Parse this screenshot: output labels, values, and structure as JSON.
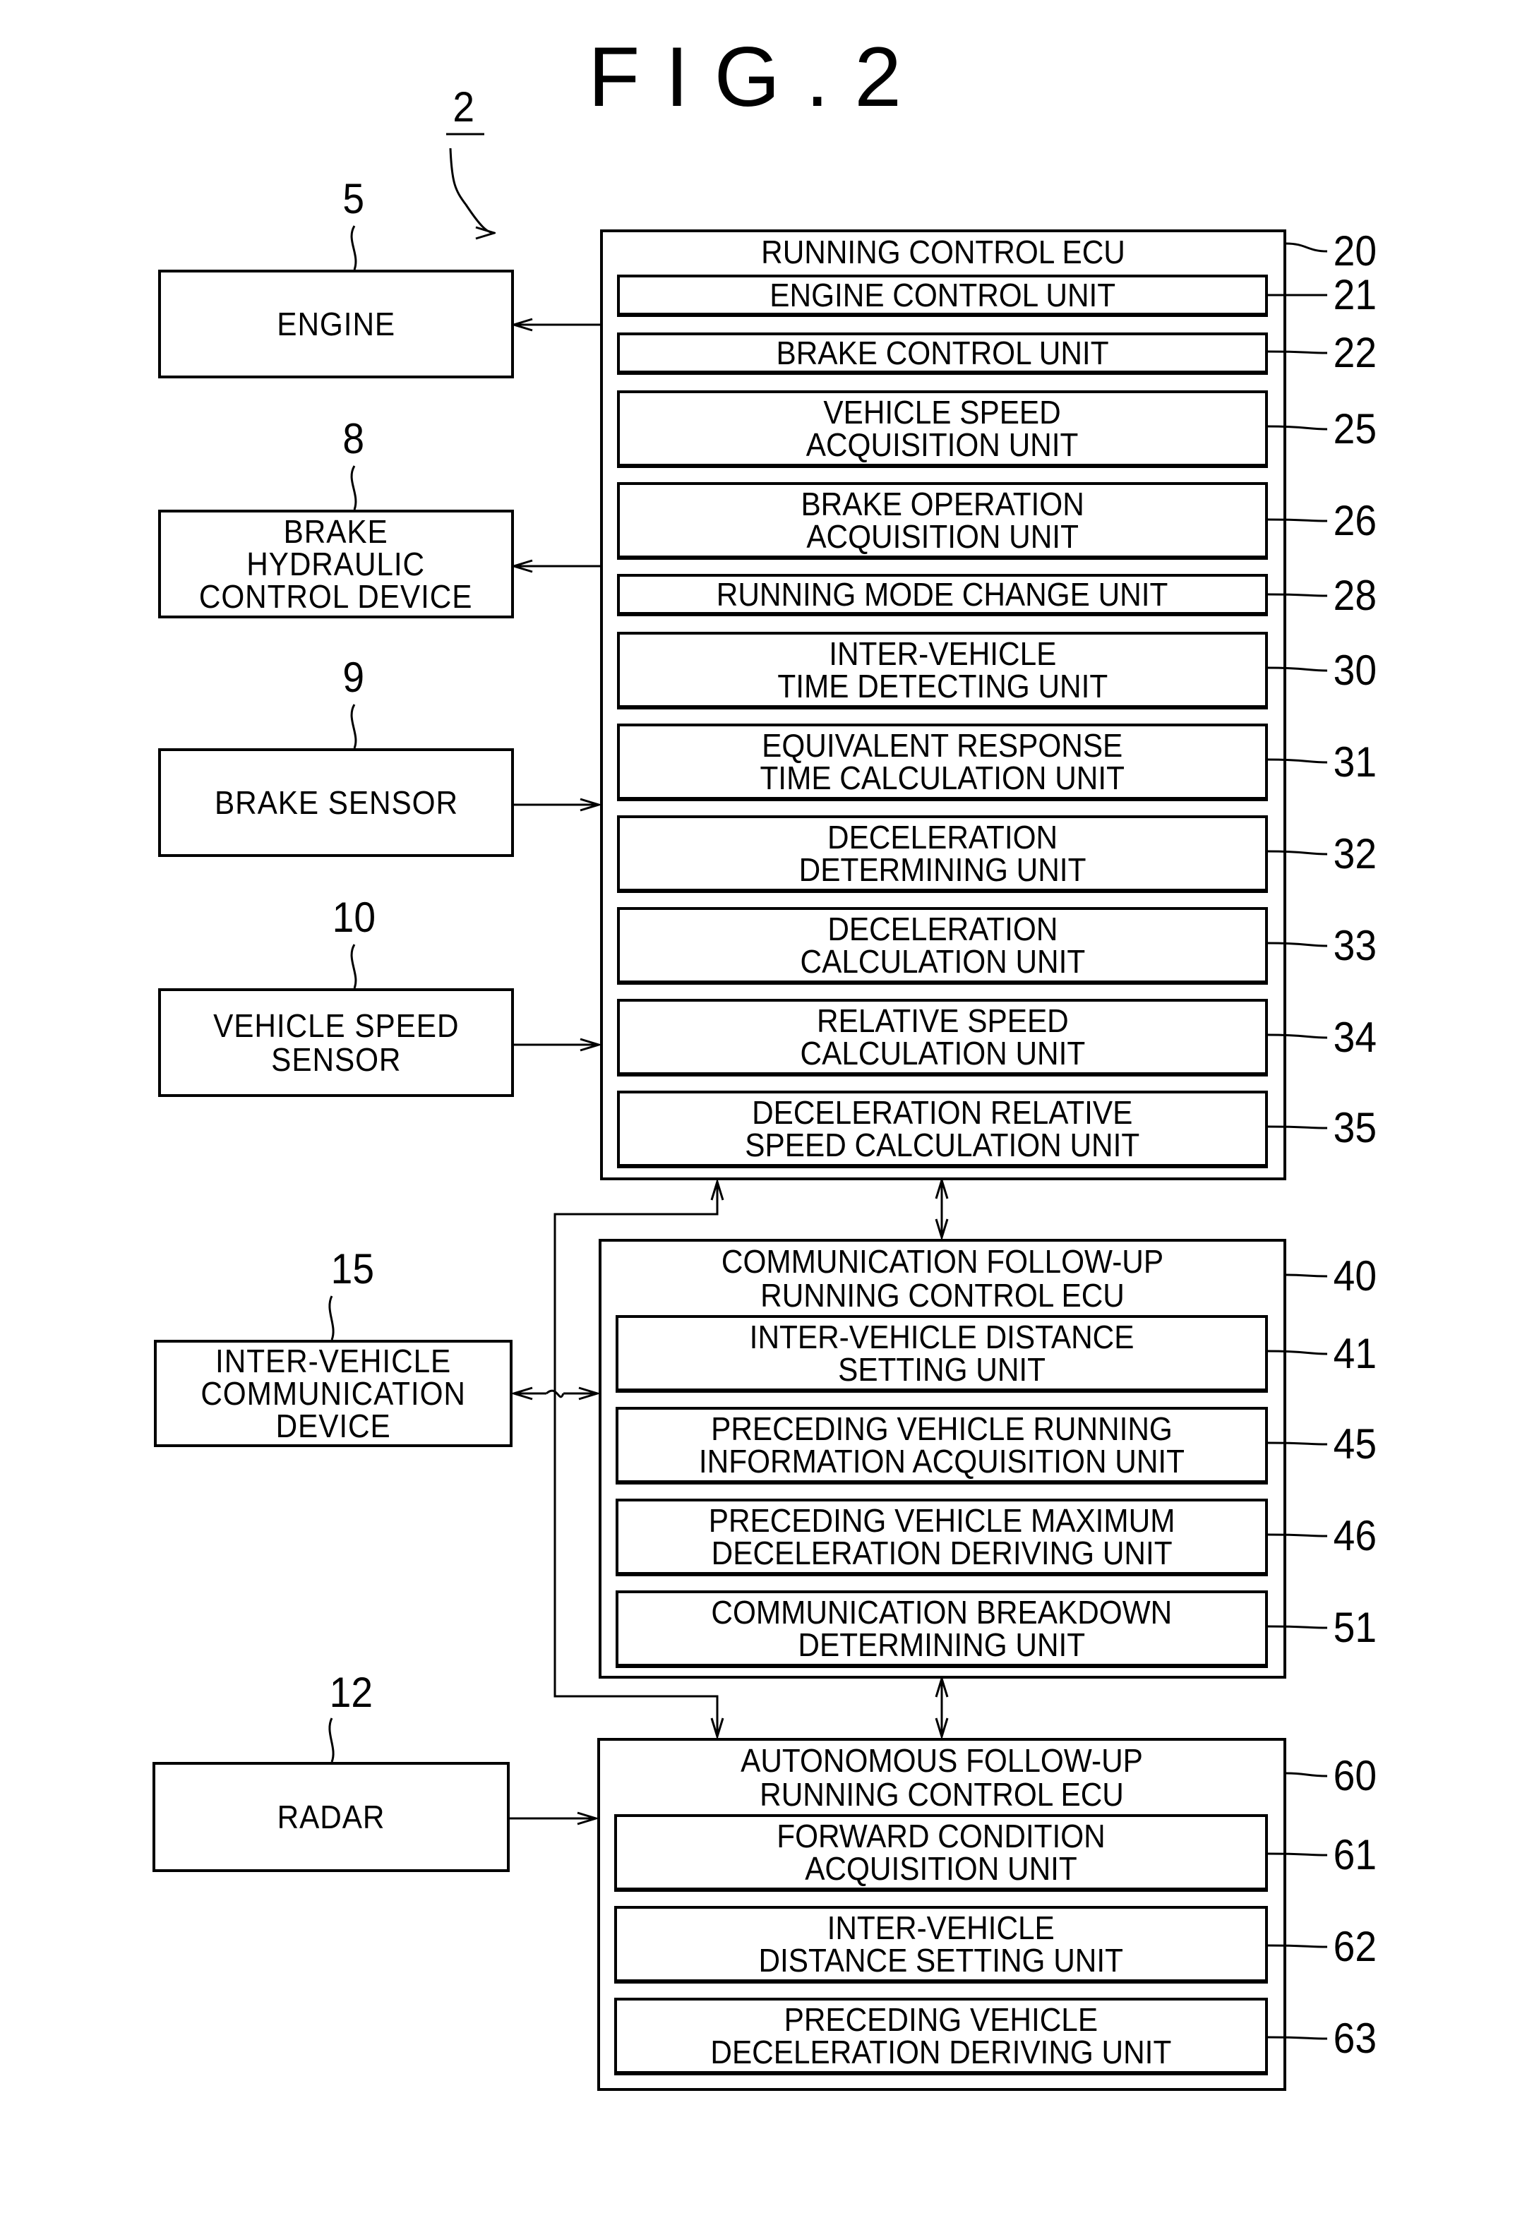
{
  "figure_title": "FIG.2",
  "system_ref": "2",
  "external_devices": [
    {
      "ref": "5",
      "label": "ENGINE"
    },
    {
      "ref": "8",
      "label": "BRAKE\nHYDRAULIC\nCONTROL DEVICE"
    },
    {
      "ref": "9",
      "label": "BRAKE SENSOR"
    },
    {
      "ref": "10",
      "label": "VEHICLE SPEED\nSENSOR"
    },
    {
      "ref": "15",
      "label": "INTER-VEHICLE\nCOMMUNICATION\nDEVICE"
    },
    {
      "ref": "12",
      "label": "RADAR"
    }
  ],
  "ecus": [
    {
      "ref": "20",
      "title": "RUNNING CONTROL ECU",
      "units": [
        {
          "ref": "21",
          "label": "ENGINE CONTROL UNIT"
        },
        {
          "ref": "22",
          "label": "BRAKE CONTROL UNIT"
        },
        {
          "ref": "25",
          "label": "VEHICLE SPEED\nACQUISITION UNIT"
        },
        {
          "ref": "26",
          "label": "BRAKE OPERATION\nACQUISITION UNIT"
        },
        {
          "ref": "28",
          "label": "RUNNING MODE CHANGE UNIT"
        },
        {
          "ref": "30",
          "label": "INTER-VEHICLE\nTIME DETECTING UNIT"
        },
        {
          "ref": "31",
          "label": "EQUIVALENT RESPONSE\nTIME CALCULATION UNIT"
        },
        {
          "ref": "32",
          "label": "DECELERATION\nDETERMINING UNIT"
        },
        {
          "ref": "33",
          "label": "DECELERATION\nCALCULATION UNIT"
        },
        {
          "ref": "34",
          "label": "RELATIVE SPEED\nCALCULATION UNIT"
        },
        {
          "ref": "35",
          "label": "DECELERATION RELATIVE\nSPEED CALCULATION UNIT"
        }
      ]
    },
    {
      "ref": "40",
      "title": "COMMUNICATION FOLLOW-UP\nRUNNING CONTROL ECU",
      "units": [
        {
          "ref": "41",
          "label": "INTER-VEHICLE DISTANCE\nSETTING UNIT"
        },
        {
          "ref": "45",
          "label": "PRECEDING VEHICLE RUNNING\nINFORMATION ACQUISITION UNIT"
        },
        {
          "ref": "46",
          "label": "PRECEDING VEHICLE MAXIMUM\nDECELERATION DERIVING UNIT"
        },
        {
          "ref": "51",
          "label": "COMMUNICATION BREAKDOWN\nDETERMINING UNIT"
        }
      ]
    },
    {
      "ref": "60",
      "title": "AUTONOMOUS FOLLOW-UP\nRUNNING CONTROL ECU",
      "units": [
        {
          "ref": "61",
          "label": "FORWARD CONDITION\nACQUISITION UNIT"
        },
        {
          "ref": "62",
          "label": "INTER-VEHICLE\nDISTANCE SETTING UNIT"
        },
        {
          "ref": "63",
          "label": "PRECEDING VEHICLE\nDECELERATION DERIVING UNIT"
        }
      ]
    }
  ]
}
